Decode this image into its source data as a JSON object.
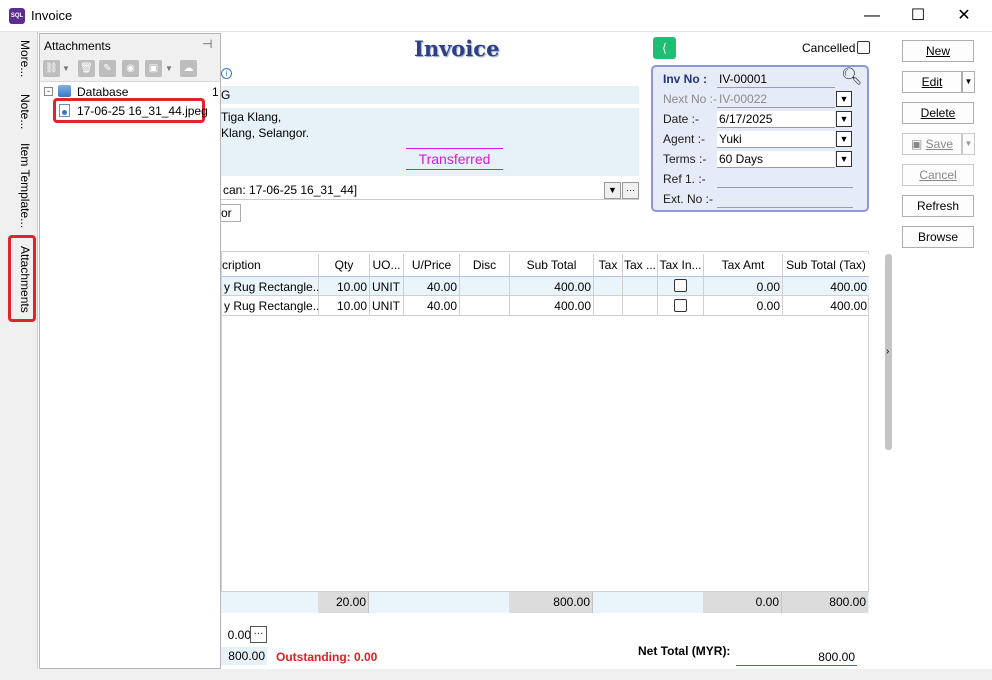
{
  "window": {
    "title": "Invoice",
    "app_icon_text": "SQL",
    "minimize": "—",
    "maximize": "☐",
    "close": "✕"
  },
  "side_tabs": [
    "More...",
    "Note...",
    "Item Template...",
    "Attachments"
  ],
  "attachments": {
    "title": "Attachments",
    "tree_root": "Database",
    "root_count": "1",
    "file_name": "17-06-25 16_31_44.jpeg"
  },
  "header": {
    "title": "Invoice",
    "cancelled_label": "Cancelled",
    "company_fragment": "G",
    "address_line1": "Tiga Klang,",
    "address_line2": "Klang, Selangor.",
    "status": "Transferred",
    "description": "can: 17-06-25 16_31_44]",
    "or_btn": "or"
  },
  "inv": {
    "inv_no_label": "Inv No :",
    "inv_no": "IV-00001",
    "next_no_label": "Next No :-",
    "next_no": "IV-00022",
    "date_label": "Date :-",
    "date": "6/17/2025",
    "agent_label": "Agent :-",
    "agent": "Yuki",
    "terms_label": "Terms :-",
    "terms": "60 Days",
    "ref_label": "Ref 1. :-",
    "ref": "",
    "ext_label": "Ext. No :-",
    "ext": ""
  },
  "actions": {
    "new": "New",
    "edit": "Edit",
    "delete": "Delete",
    "save": "Save",
    "cancel": "Cancel",
    "refresh": "Refresh",
    "browse": "Browse"
  },
  "grid": {
    "headers": [
      "cription",
      "Qty",
      "UO...",
      "U/Price",
      "Disc",
      "Sub Total",
      "Tax",
      "Tax ...",
      "Tax In...",
      "Tax Amt",
      "Sub Total (Tax)"
    ],
    "rows": [
      {
        "desc": "y Rug Rectangle...",
        "qty": "10.00",
        "uom": "UNIT",
        "price": "40.00",
        "disc": "",
        "subtotal": "400.00",
        "tax": "",
        "taxrate": "",
        "taxamt": "0.00",
        "subtotal_tax": "400.00"
      },
      {
        "desc": "y Rug Rectangle...",
        "qty": "10.00",
        "uom": "UNIT",
        "price": "40.00",
        "disc": "",
        "subtotal": "400.00",
        "tax": "",
        "taxrate": "",
        "taxamt": "0.00",
        "subtotal_tax": "400.00"
      }
    ],
    "footer": {
      "qty": "20.00",
      "subtotal": "800.00",
      "taxamt": "0.00",
      "subtotal_tax": "800.00"
    }
  },
  "totals": {
    "discount": "0.00",
    "paid": "800.00",
    "outstanding": "Outstanding: 0.00",
    "net_label": "Net Total (MYR):",
    "net_value": "800.00"
  }
}
